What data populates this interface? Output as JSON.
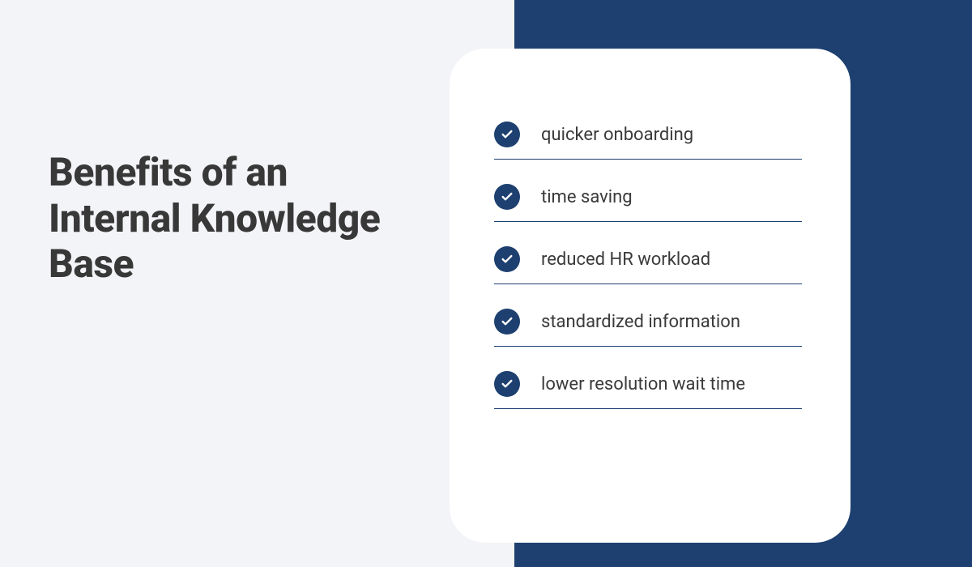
{
  "heading": "Benefits of an Internal Knowledge Base",
  "benefits": [
    "quicker onboarding",
    "time saving",
    "reduced HR workload",
    "standardized information",
    "lower resolution wait time"
  ],
  "colors": {
    "accent": "#1d4070",
    "bg_light": "#f3f4f7",
    "text_heading": "#383838",
    "text_body": "#3a3a3a"
  }
}
